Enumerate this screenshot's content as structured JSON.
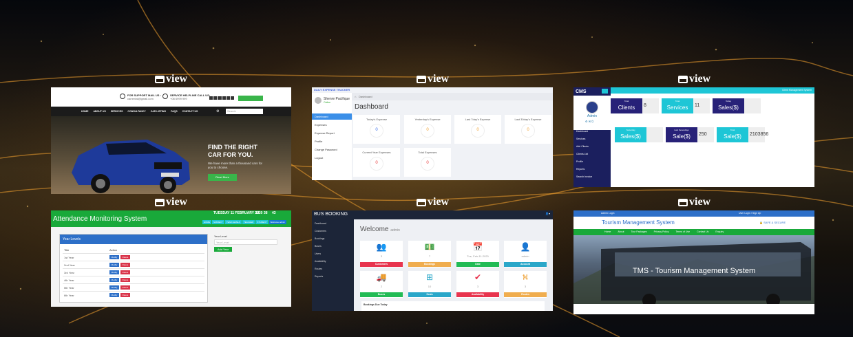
{
  "view_label": "view",
  "cards": {
    "car": {
      "support_mail": "FOR SUPPORT MAIL US :",
      "support_mail_value": "carrental@gmail.com",
      "service_call": "SERVICE HELPLINE CALL US:",
      "service_call_value": "+08 6999 999",
      "nav": [
        "HOME",
        "ABOUT US",
        "SERVICES",
        "CONSULTANCY",
        "CAR LISTING",
        "FAQS",
        "CONTACT US"
      ],
      "search_placeholder": "Search",
      "headline1": "FIND THE RIGHT",
      "headline2": "CAR FOR YOU.",
      "subtext": "We have more than a thousand cars for you to choose.",
      "button": "Read More"
    },
    "expense": {
      "header": "DAILY EXPENSE TRACKER",
      "user_name": "Shenre Pacifique",
      "user_status": "Online",
      "breadcrumb": "Dashboard",
      "title": "Dashboard",
      "menu": [
        "Dashboard",
        "Expenses",
        "Expense Report",
        "Profile",
        "Change Password",
        "Logout"
      ],
      "stats": [
        {
          "label": "Today's Expense",
          "value": "0"
        },
        {
          "label": "Yesterday's Expense",
          "value": "0"
        },
        {
          "label": "Last 7day's Expense",
          "value": "0"
        },
        {
          "label": "Last 30day's Expense",
          "value": "0"
        },
        {
          "label": "Current Year Expenses",
          "value": "0"
        },
        {
          "label": "Total Expenses",
          "value": "0"
        }
      ]
    },
    "cms": {
      "brand": "CMS",
      "user": "Admin",
      "top_right": "Client Management System",
      "menu": [
        "Dashboard",
        "Services",
        "Add Clients",
        "Clients List",
        "Profile",
        "Reports",
        "Search Invoice"
      ],
      "row1": [
        {
          "small": "Total",
          "big": "Clients",
          "value": "8",
          "color": "#272178"
        },
        {
          "small": "Total",
          "big": "Services",
          "value": "11",
          "color": "#1ec6d6"
        },
        {
          "small": "Today",
          "big": "Sales($)",
          "value": "",
          "color": "#272178"
        }
      ],
      "row2": [
        {
          "small": "Yesterday",
          "big": "Sales($)",
          "value": "",
          "color": "#1ec6d6"
        },
        {
          "small": "Last Sevendays",
          "big": "Sale($)",
          "value": "250",
          "color": "#272178"
        },
        {
          "small": "Total",
          "big": "Sale($)",
          "value": "2103856",
          "color": "#1ec6d6"
        }
      ]
    },
    "attendance": {
      "title": "Attendance Monitoring System",
      "clock_date": "TUESDAY 11 FEBRUARY 2020",
      "clock_h": "12",
      "clock_m": "38",
      "clock_s": "43",
      "nav": [
        "HOME",
        "SUBJECT",
        "YEAR LEVELS",
        "TEACHER",
        "STUDENT",
        "Welcome admin"
      ],
      "panel_title": "Year Levels",
      "col_title": "Title",
      "col_action": "Action",
      "rows": [
        "1st Year",
        "2nd Year",
        "3rd Year",
        "4th Year",
        "5th Year",
        "6th Year"
      ],
      "btn_modify": "Modify",
      "btn_delete": "Delete",
      "form_label": "Year Level",
      "form_placeholder": "Year Level",
      "form_button": "Add Year Level"
    },
    "bus": {
      "brand": "BUS BOOKING",
      "menu": [
        "Dashboard",
        "Customers",
        "Bookings",
        "Buses",
        "Users",
        "Availability",
        "Routes",
        "Reports"
      ],
      "welcome": "Welcome",
      "welcome_user": "admin",
      "tiles": [
        {
          "value": "3",
          "label": "Customers",
          "color": "#e8344e",
          "icon": "users-icon",
          "glyph": "👥"
        },
        {
          "value": "7",
          "label": "Bookings",
          "color": "#f0ad4e",
          "icon": "money-icon",
          "glyph": "💵"
        },
        {
          "value": "Tue, Feb-11-2020",
          "label": "Date",
          "color": "#22bb55",
          "icon": "calendar-icon",
          "glyph": "📅"
        },
        {
          "value": "admin",
          "label": "Account",
          "color": "#2aa7c9",
          "icon": "user-icon",
          "glyph": "👤"
        },
        {
          "value": "2",
          "label": "Buses",
          "color": "#22bb55",
          "icon": "truck-icon",
          "glyph": "🚚"
        },
        {
          "value": "10",
          "label": "Seats",
          "color": "#2aa7c9",
          "icon": "sitemap-icon",
          "glyph": "⊞"
        },
        {
          "value": "3",
          "label": "Availability",
          "color": "#e8344e",
          "icon": "check-icon",
          "glyph": "✔"
        },
        {
          "value": "3",
          "label": "Routes",
          "color": "#f0ad4e",
          "icon": "road-icon",
          "glyph": "⛕"
        }
      ],
      "bookings_title": "Bookings Due Today"
    },
    "tms": {
      "top_left": "Admin Login",
      "top_right": "User Login / Sign Up",
      "brand": "Tourism Management System",
      "secure": "SAFE & SECURE",
      "nav": [
        "Home",
        "About",
        "Tour Packages",
        "Privacy Policy",
        "Terms of Use",
        "Contact Us",
        "Enquiry"
      ],
      "hero": "TMS - Tourism Management System"
    }
  }
}
